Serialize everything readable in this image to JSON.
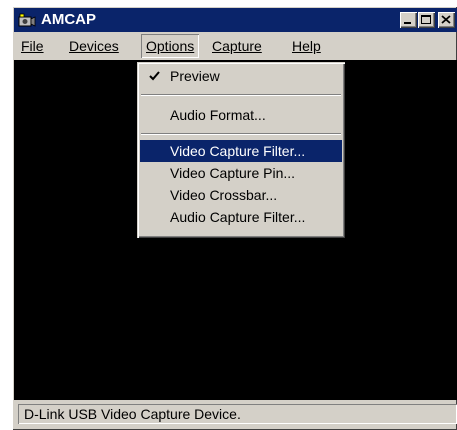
{
  "window": {
    "title": "AMCAP",
    "app_icon": "camera-icon",
    "caption_buttons": [
      "minimize-icon",
      "maximize-icon",
      "close-icon"
    ]
  },
  "menubar": {
    "items": [
      {
        "label": "File"
      },
      {
        "label": "Devices"
      },
      {
        "label": "Options"
      },
      {
        "label": "Capture"
      },
      {
        "label": "Help"
      }
    ],
    "open_menu": "Options"
  },
  "options_menu": {
    "items": [
      {
        "label": "Preview",
        "checked": true
      },
      {
        "label": "Audio Format..."
      },
      {
        "label": "Video Capture Filter...",
        "selected": true
      },
      {
        "label": "Video Capture Pin..."
      },
      {
        "label": "Video Crossbar..."
      },
      {
        "label": "Audio Capture Filter..."
      }
    ]
  },
  "statusbar": {
    "text": "D-Link USB Video Capture Device."
  },
  "colors": {
    "titlebar": "#0a246a",
    "face": "#d4d0c8",
    "selection": "#0a246a",
    "preview_area": "#000000"
  }
}
